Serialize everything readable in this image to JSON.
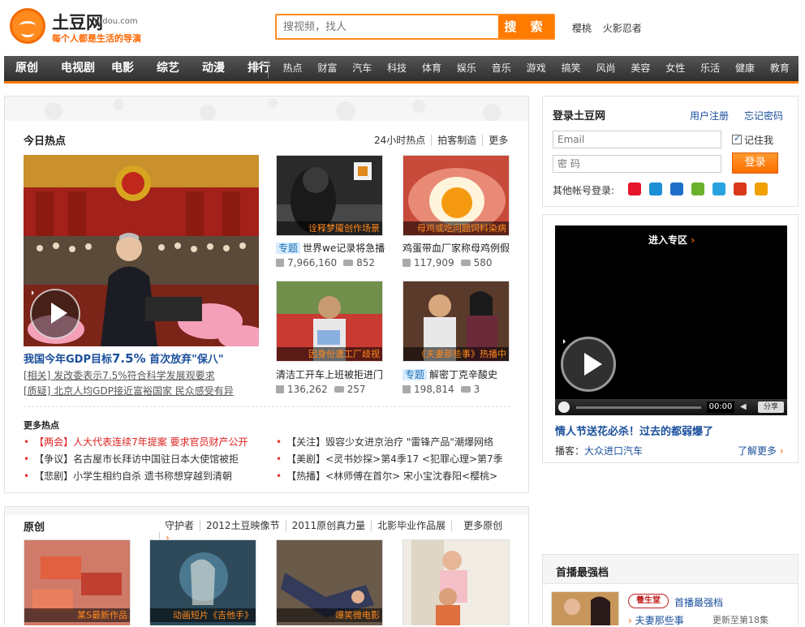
{
  "header": {
    "logo_name": "土豆网",
    "logo_domain": "tudou.com",
    "slogan": "每个人都是生活的导演",
    "search_placeholder": "搜视频，找人",
    "search_button": "搜 索",
    "hot_words": [
      "樱桃",
      "火影忍者"
    ]
  },
  "nav": {
    "main": [
      "原创",
      "电视剧",
      "电影",
      "综艺",
      "动漫",
      "排行"
    ],
    "sub": [
      "热点",
      "财富",
      "汽车",
      "科技",
      "体育",
      "娱乐",
      "音乐",
      "游戏",
      "搞笑",
      "风尚",
      "美容",
      "女性",
      "乐活",
      "健康",
      "教育"
    ]
  },
  "hot": {
    "title": "今日热点",
    "links": [
      "24小时热点",
      "拍客制造",
      "更多"
    ],
    "main_title_pre": "我国今年GDP目标",
    "main_title_pct": "7.5%",
    "main_title_post": " 首次放弃\"保八\"",
    "related": [
      "[相关] 发改委表示7.5%符合科学发展观要求",
      "[质疑] 北京人均GDP接近富裕国家 民众感受有异"
    ],
    "items": [
      {
        "caption": "诠释梦魇创作场景",
        "tag": "专题",
        "title": "世界we记录将急播",
        "plays": "7,966,160",
        "comments": "852"
      },
      {
        "caption": "母鸡或吃问题饲料染病",
        "tag": "",
        "title": "鸡蛋带血厂家称母鸡例假",
        "plays": "117,909",
        "comments": "580"
      },
      {
        "caption": "因身份遭工厂歧视",
        "tag": "",
        "title": "清洁工开车上班被拒进门",
        "plays": "136,262",
        "comments": "257"
      },
      {
        "caption": "《夫妻那些事》热播中",
        "tag": "专题",
        "title": "解密丁克辛酸史",
        "plays": "198,814",
        "comments": "3"
      }
    ],
    "more_title": "更多热点",
    "more_left": [
      {
        "tag": "【两会】",
        "text": "人大代表连续7年提案 要求官员财产公开",
        "red": true
      },
      {
        "tag": "【争议】",
        "text": "名古屋市长拜访中国驻日本大使馆被拒",
        "red": false
      },
      {
        "tag": "【悲剧】",
        "text": "小学生相约自杀 遗书称想穿越到清朝",
        "red": false
      }
    ],
    "more_right": [
      {
        "tag": "【关注】",
        "text": "毁容少女进京治疗   \"雷锋产品\"潮爆网络"
      },
      {
        "tag": "【美剧】",
        "text": "<灵书妙探>第4季17    <犯罪心理>第7季"
      },
      {
        "tag": "【热播】",
        "text": "<林师傅在首尔>    宋小宝沈春阳<樱桃>"
      }
    ]
  },
  "login": {
    "title": "登录土豆网",
    "register": "用户注册",
    "forgot": "忘记密码",
    "email_placeholder": "Email",
    "password_placeholder": "密 码",
    "remember": "记住我",
    "button": "登录",
    "other": "其他帐号登录:",
    "social_colors": [
      "#e6162d",
      "#1c8fd6",
      "#1f6ec9",
      "#6bb22a",
      "#29a3e0",
      "#d9391a",
      "#f0a000"
    ]
  },
  "player": {
    "enter": "进入专区",
    "time": "00:00",
    "share": "分享",
    "title": "情人节送花必杀！过去的都弱爆了",
    "sponsor_label": "播客：",
    "sponsor": "大众进口汽车",
    "more": "了解更多"
  },
  "orig": {
    "title": "原创",
    "links": [
      "守护者",
      "2012土豆映像节",
      "2011原创真力量",
      "北影毕业作品展",
      "更多原创"
    ],
    "captions": [
      "某S最新作品",
      "动画短片《吉他手》",
      "爆笑微电影",
      ""
    ]
  },
  "premier": {
    "title": "首播最强档",
    "brand": "養生堂",
    "label": "首播最强档",
    "show": "夫妻那些事",
    "update": "更新至第18集"
  }
}
